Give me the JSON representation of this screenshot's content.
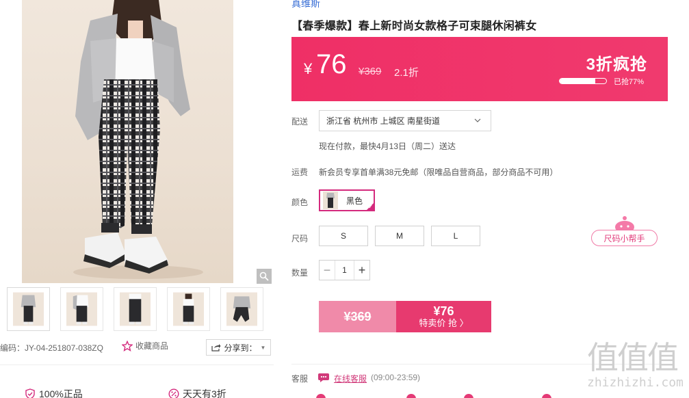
{
  "product": {
    "brand": "真维斯",
    "title": "【春季爆款】春上新时尚女款格子可束腿休闲裤女"
  },
  "price": {
    "currency": "¥",
    "now": "76",
    "original": "¥369",
    "discount": "2.1折",
    "promo": "3折疯抢",
    "progress": 0.77,
    "progress_text": "已抢77%"
  },
  "delivery": {
    "label": "配送",
    "address": "浙江省 杭州市 上城区 南星街道",
    "note": "现在付款，最快4月13日（周二）送达"
  },
  "shipping": {
    "label": "运费",
    "note": "新会员专享首单满38元免邮（限唯品自营商品，部分商品不可用）"
  },
  "color": {
    "label": "颜色",
    "options": [
      {
        "name": "黑色",
        "selected": true
      }
    ]
  },
  "size": {
    "label": "尺码",
    "options": [
      "S",
      "M",
      "L"
    ],
    "helper": "尺码小帮手"
  },
  "quantity": {
    "label": "数量",
    "value": "1"
  },
  "buy": {
    "original": "¥369",
    "price": "¥76",
    "action": "特卖价 抢 〉"
  },
  "service": {
    "label": "客服",
    "link": "在线客服",
    "hours": "(09:00-23:59)"
  },
  "gallery": {
    "sku_code": "编码：JY-04-251807-038ZQ",
    "favorite": "收藏商品",
    "share": "分享到："
  },
  "guarantees": [
    "100%正品",
    "天天有3折"
  ],
  "watermark": {
    "glyphs": "值值值",
    "site": "zhizhizhi.com"
  },
  "colors": {
    "accent": "#ef2f66",
    "selected_border": "#d42a7d",
    "brand_link": "#3a6fd6"
  }
}
